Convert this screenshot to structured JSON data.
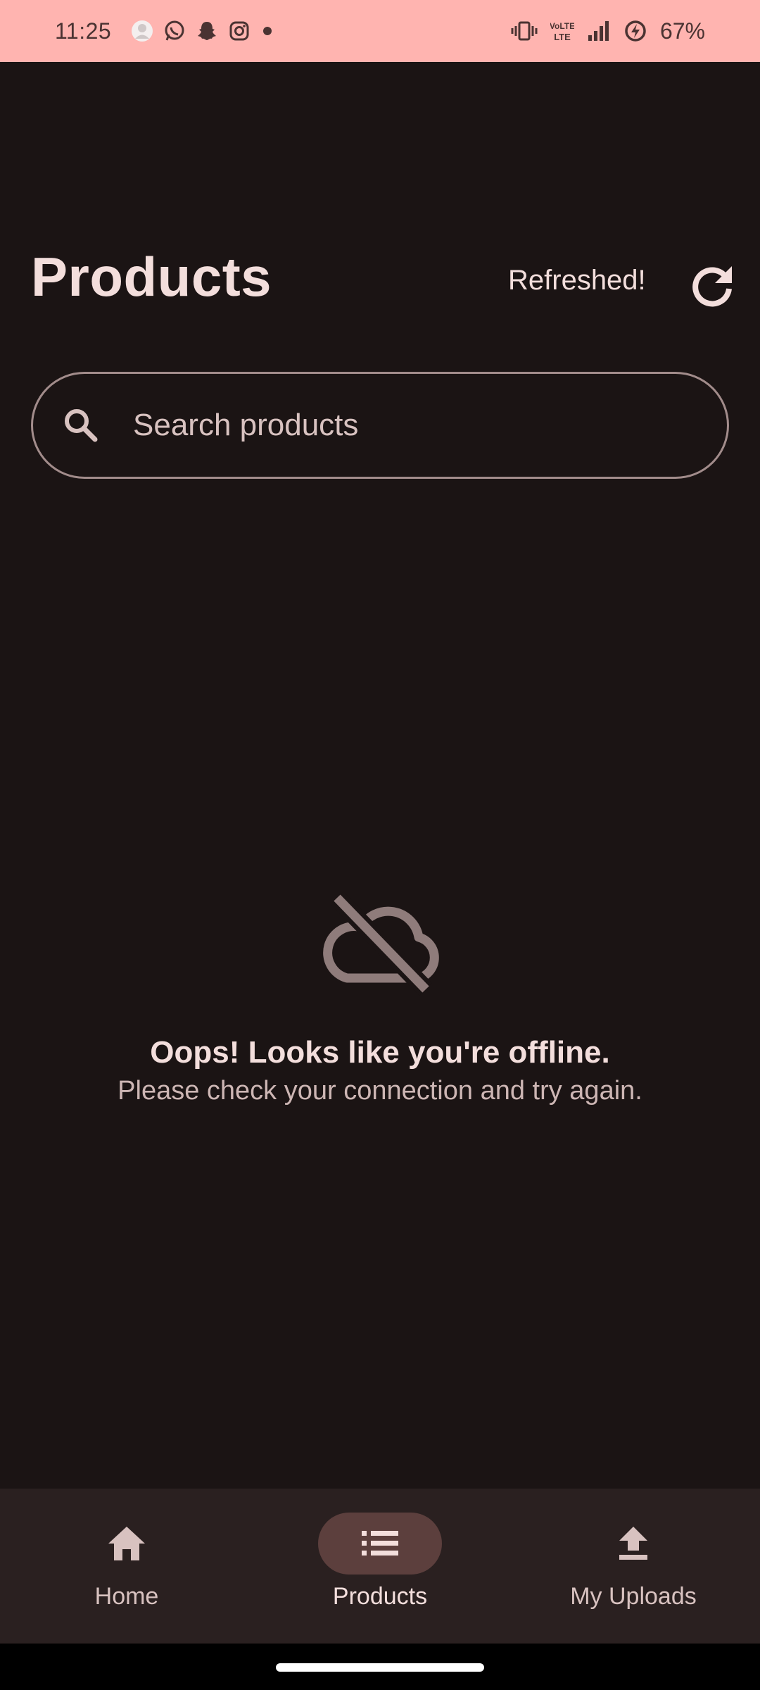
{
  "status_bar": {
    "time": "11:25",
    "battery": "67%",
    "notification_icons": [
      "avatar-icon",
      "whatsapp-icon",
      "snapchat-icon",
      "instagram-icon",
      "dot-icon"
    ],
    "system_icons": [
      "vibrate-icon",
      "volte-icon",
      "signal-icon",
      "battery-saver-icon"
    ]
  },
  "header": {
    "title": "Products",
    "refresh_status": "Refreshed!",
    "refresh_icon": "refresh-icon"
  },
  "search": {
    "placeholder": "Search products",
    "value": ""
  },
  "offline": {
    "icon": "cloud-off-icon",
    "title": "Oops! Looks like you're offline.",
    "subtitle": "Please check your connection and try again."
  },
  "bottom_nav": {
    "items": [
      {
        "label": "Home",
        "icon": "home-icon",
        "active": false
      },
      {
        "label": "Products",
        "icon": "list-icon",
        "active": true
      },
      {
        "label": "My Uploads",
        "icon": "upload-icon",
        "active": false
      }
    ]
  },
  "colors": {
    "background": "#1b1414",
    "status_bar": "#ffb4b0",
    "text_primary": "#f3dedc",
    "text_secondary": "#cdb6b4",
    "nav_background": "#2a2020",
    "nav_active_pill": "#5c3f3d",
    "outline": "#a28c8b"
  }
}
